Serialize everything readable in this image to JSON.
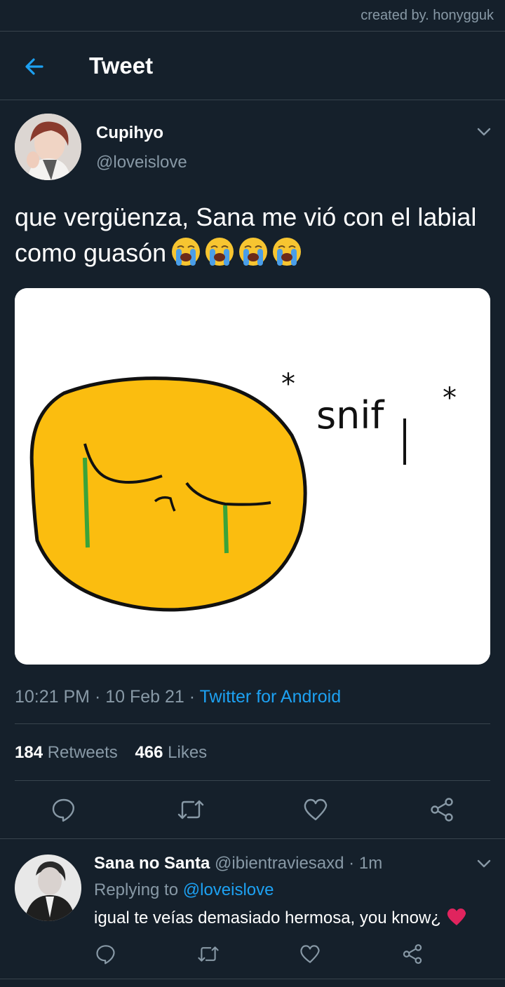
{
  "credit": "created by. honygguk",
  "header": {
    "title": "Tweet",
    "back_icon": "arrow-left-icon"
  },
  "tweet": {
    "author_name": "Cupihyo",
    "author_handle": "@loveislove",
    "text": "que vergüenza, Sana me vió con el labial como guasón",
    "emoji": "loudly-crying-face x4",
    "media": {
      "text": "*snif*"
    },
    "time": "10:21 PM",
    "date": "10 Feb 21",
    "separator": "·",
    "source": "Twitter for Android",
    "retweets_count": "184",
    "retweets_label": "Retweets",
    "likes_count": "466",
    "likes_label": "Likes"
  },
  "reply": {
    "name": "Sana no Santa",
    "handle": "@ibientraviesaxd",
    "separator": "·",
    "time": "1m",
    "replying_prefix": "Replying to",
    "replying_to": "@loveislove",
    "text": "igual te veías demasiado hermosa, you know¿"
  },
  "colors": {
    "background": "#15202b",
    "accent": "#1da1f2",
    "secondary_text": "#8899a6",
    "divider": "#38444d",
    "heart": "#e0245e"
  }
}
